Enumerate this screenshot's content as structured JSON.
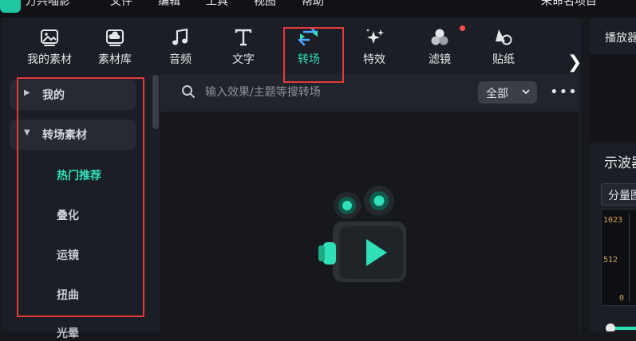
{
  "menubar": {
    "items": [
      "万兴喵影",
      "文件",
      "编辑",
      "工具",
      "视图",
      "帮助"
    ],
    "right_text": "未命名项目"
  },
  "toolbar": {
    "tabs": [
      {
        "label": "我的素材",
        "icon": "image-folder-icon"
      },
      {
        "label": "素材库",
        "icon": "cloud-folder-icon"
      },
      {
        "label": "音频",
        "icon": "music-note-icon"
      },
      {
        "label": "文字",
        "icon": "text-icon"
      },
      {
        "label": "转场",
        "icon": "transition-arrows-icon",
        "active": true
      },
      {
        "label": "特效",
        "icon": "sparkle-star-icon"
      },
      {
        "label": "滤镜",
        "icon": "filter-circles-icon",
        "notification": true
      },
      {
        "label": "贴纸",
        "icon": "sticker-icon"
      }
    ],
    "next_icon": "chevron-right-icon"
  },
  "sidebar": {
    "groups": [
      {
        "label": "我的",
        "expanded": false
      },
      {
        "label": "转场素材",
        "expanded": true
      }
    ],
    "items": [
      {
        "label": "热门推荐",
        "active": true
      },
      {
        "label": "叠化"
      },
      {
        "label": "运镜"
      },
      {
        "label": "扭曲"
      },
      {
        "label": "光晕"
      }
    ]
  },
  "search": {
    "placeholder": "输入效果/主题等搜转场",
    "filter_value": "全部"
  },
  "right_panel": {
    "tab_label": "播放器",
    "title": "示波器",
    "mode_value": "分量图",
    "scope_ticks": [
      "1023",
      "512",
      "0"
    ]
  },
  "colors": {
    "accent": "#2fe0b8",
    "highlight_box": "#e53b3b",
    "notification_dot": "#ff4d4f",
    "background": "#16181d",
    "panel": "#1b1e24"
  }
}
